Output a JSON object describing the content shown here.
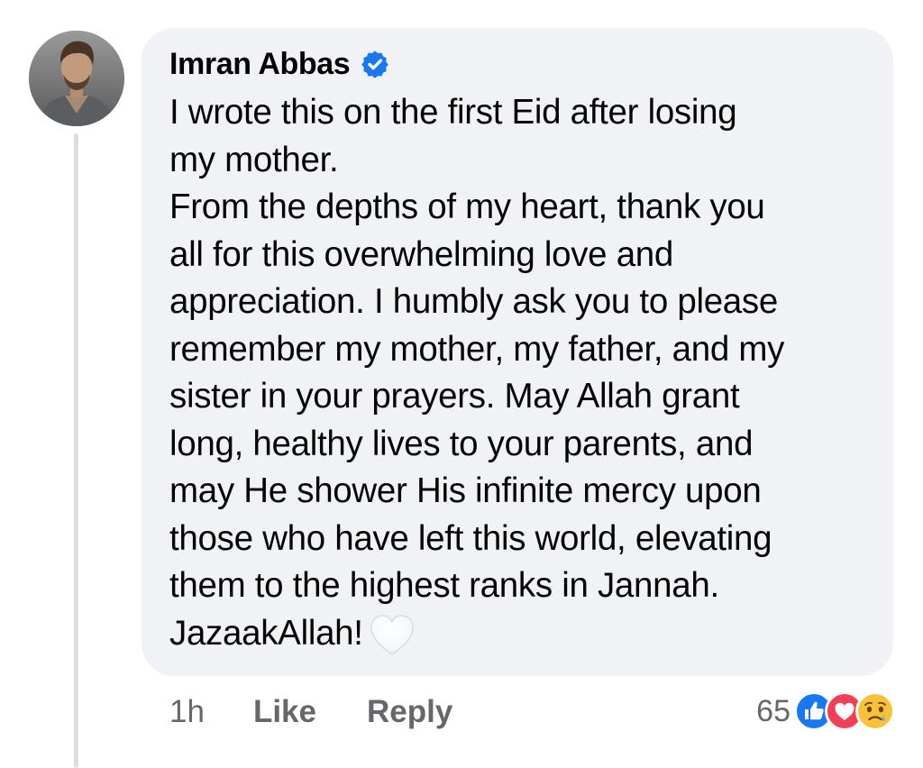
{
  "comment": {
    "author": "Imran Abbas",
    "verified": true,
    "body_lines": [
      "I wrote this on the first Eid after losing",
      "my mother.",
      "From the depths of my heart, thank you",
      "all for this overwhelming love and",
      "appreciation. I humbly ask you to please",
      "remember my mother, my father, and my",
      "sister in your prayers. May Allah grant",
      "long, healthy lives to your parents, and",
      "may He shower His infinite mercy upon",
      "those who have left this world, elevating",
      "them to the highest ranks in Jannah.",
      "JazaakAllah!"
    ],
    "trailing_emoji": "white-heart"
  },
  "actions": {
    "time": "1h",
    "like_label": "Like",
    "reply_label": "Reply"
  },
  "reactions": {
    "count": "65",
    "types": [
      "like",
      "love",
      "sad"
    ]
  },
  "colors": {
    "bubble_bg": "#f0f2f5",
    "meta_text": "#65676b",
    "facebook_blue": "#1877f2",
    "love_red": "#f33e58"
  }
}
